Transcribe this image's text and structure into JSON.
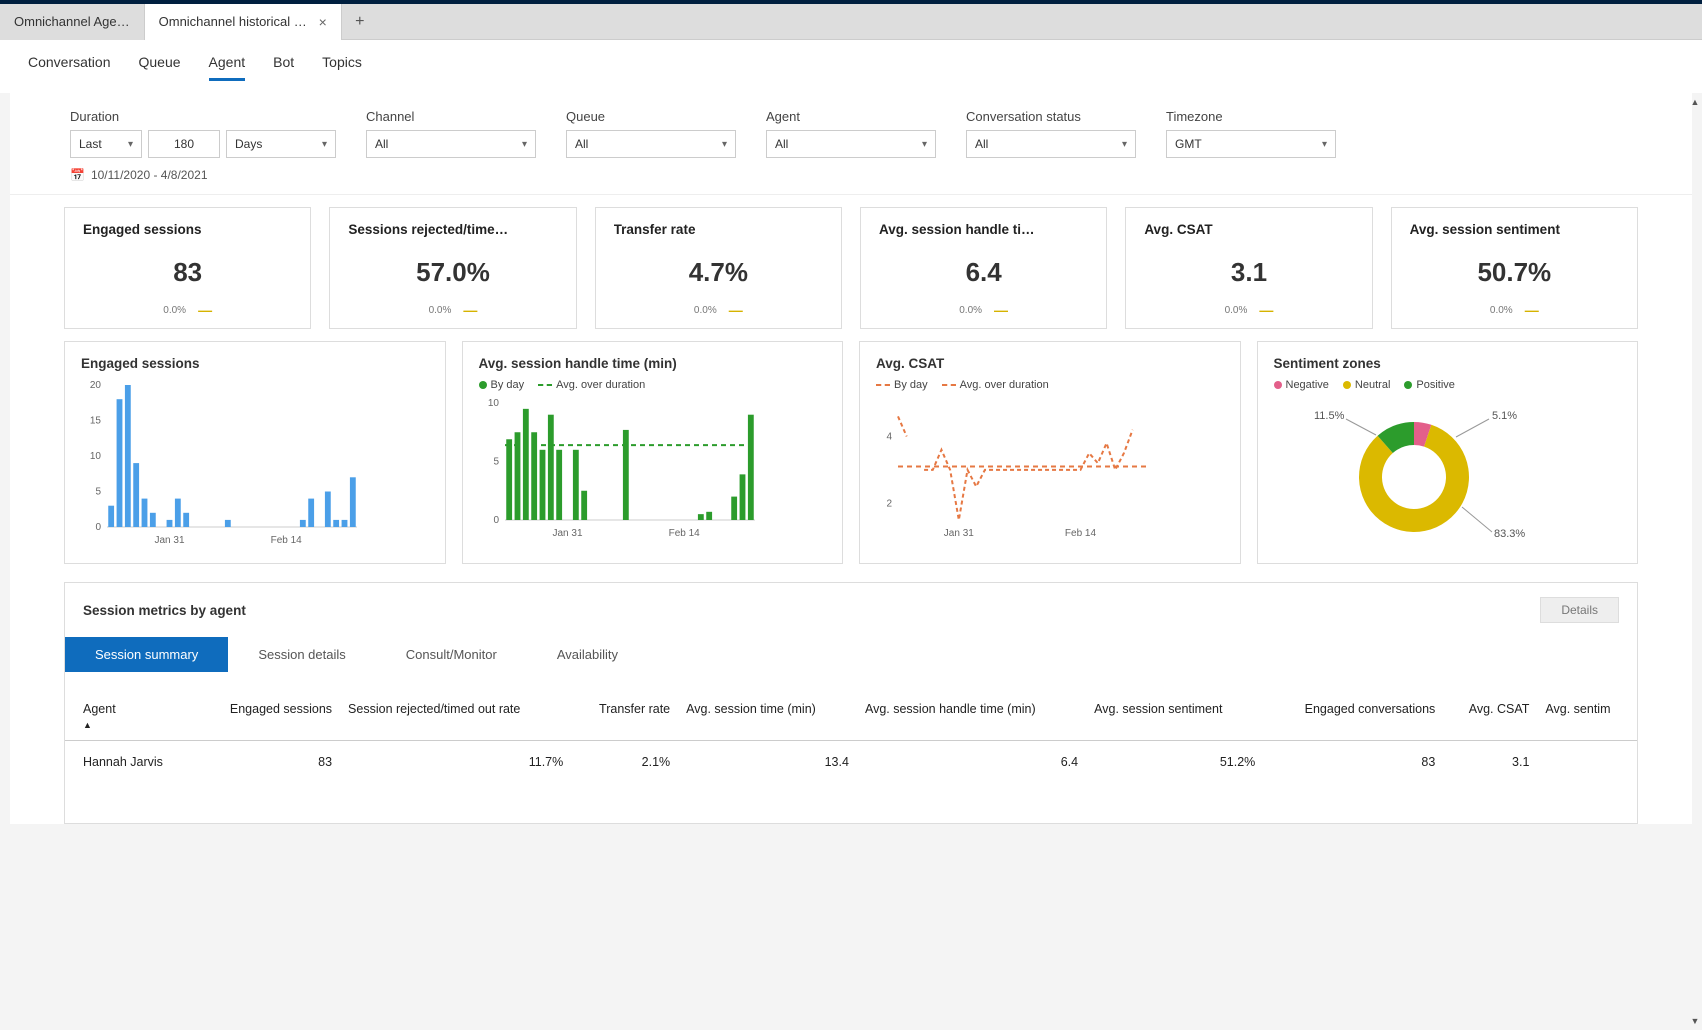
{
  "tabs": {
    "inactive": "Omnichannel Age…",
    "active": "Omnichannel historical an…"
  },
  "page_tabs": [
    "Conversation",
    "Queue",
    "Agent",
    "Bot",
    "Topics"
  ],
  "active_page_tab": "Agent",
  "filters": {
    "duration": {
      "label": "Duration",
      "mode": "Last",
      "value": "180",
      "unit": "Days"
    },
    "channel": {
      "label": "Channel",
      "value": "All"
    },
    "queue": {
      "label": "Queue",
      "value": "All"
    },
    "agent": {
      "label": "Agent",
      "value": "All"
    },
    "status": {
      "label": "Conversation status",
      "value": "All"
    },
    "timezone": {
      "label": "Timezone",
      "value": "GMT"
    }
  },
  "date_range": "10/11/2020 - 4/8/2021",
  "kpis": [
    {
      "title": "Engaged sessions",
      "value": "83",
      "delta": "0.0%"
    },
    {
      "title": "Sessions rejected/time…",
      "value": "57.0%",
      "delta": "0.0%"
    },
    {
      "title": "Transfer rate",
      "value": "4.7%",
      "delta": "0.0%"
    },
    {
      "title": "Avg. session handle ti…",
      "value": "6.4",
      "delta": "0.0%"
    },
    {
      "title": "Avg. CSAT",
      "value": "3.1",
      "delta": "0.0%"
    },
    {
      "title": "Avg. session sentiment",
      "value": "50.7%",
      "delta": "0.0%"
    }
  ],
  "charts": {
    "engaged": {
      "title": "Engaged sessions"
    },
    "handle": {
      "title": "Avg. session handle time (min)",
      "legend_byday": "By day",
      "legend_avg": "Avg. over duration"
    },
    "csat": {
      "title": "Avg. CSAT",
      "legend_byday": "By day",
      "legend_avg": "Avg. over duration"
    },
    "sentiment": {
      "title": "Sentiment zones",
      "legend_neg": "Negative",
      "legend_neu": "Neutral",
      "legend_pos": "Positive",
      "neg": "5.1%",
      "neu": "83.3%",
      "pos": "11.5%"
    }
  },
  "axis": {
    "jan31": "Jan 31",
    "feb14": "Feb 14"
  },
  "chart_data": [
    {
      "id": "engaged_sessions",
      "type": "bar",
      "title": "Engaged sessions",
      "ylabel": "",
      "ylim": [
        0,
        20
      ],
      "yticks": [
        0,
        5,
        10,
        15,
        20
      ],
      "x_ticks_shown": [
        "Jan 31",
        "Feb 14"
      ],
      "x": [
        "Jan 24",
        "Jan 25",
        "Jan 26",
        "Jan 27",
        "Jan 28",
        "Jan 29",
        "Jan 30",
        "Jan 31",
        "Feb 1",
        "Feb 2",
        "Feb 3",
        "Feb 4",
        "Feb 5",
        "Feb 6",
        "Feb 7",
        "Feb 8",
        "Feb 9",
        "Feb 10",
        "Feb 11",
        "Feb 12",
        "Feb 13",
        "Feb 14",
        "Feb 15",
        "Feb 16",
        "Feb 17",
        "Feb 18",
        "Feb 19",
        "Feb 20",
        "Feb 21",
        "Feb 22"
      ],
      "values": [
        3,
        18,
        20,
        9,
        4,
        2,
        0,
        1,
        4,
        2,
        0,
        0,
        0,
        0,
        1,
        0,
        0,
        0,
        0,
        0,
        0,
        0,
        0,
        1,
        4,
        0,
        5,
        1,
        1,
        7
      ]
    },
    {
      "id": "avg_session_handle_time",
      "type": "bar",
      "title": "Avg. session handle time (min)",
      "ylabel": "",
      "ylim": [
        0,
        10
      ],
      "yticks": [
        0,
        5,
        10
      ],
      "x_ticks_shown": [
        "Jan 31",
        "Feb 14"
      ],
      "x": [
        "Jan 24",
        "Jan 25",
        "Jan 26",
        "Jan 27",
        "Jan 28",
        "Jan 29",
        "Jan 30",
        "Jan 31",
        "Feb 1",
        "Feb 2",
        "Feb 3",
        "Feb 4",
        "Feb 5",
        "Feb 6",
        "Feb 7",
        "Feb 8",
        "Feb 9",
        "Feb 10",
        "Feb 11",
        "Feb 12",
        "Feb 13",
        "Feb 14",
        "Feb 15",
        "Feb 16",
        "Feb 17",
        "Feb 18",
        "Feb 19",
        "Feb 20",
        "Feb 21",
        "Feb 22"
      ],
      "series": [
        {
          "name": "By day",
          "type": "bar",
          "values": [
            6.9,
            7.5,
            9.5,
            7.5,
            6.0,
            9.0,
            6.0,
            0,
            6.0,
            2.5,
            0,
            0,
            0,
            0,
            7.7,
            0,
            0,
            0,
            0,
            0,
            0,
            0,
            0,
            0.5,
            0.7,
            0,
            0,
            2.0,
            3.9,
            9.0
          ]
        },
        {
          "name": "Avg. over duration",
          "type": "line",
          "style": "dashed",
          "value": 6.4
        }
      ]
    },
    {
      "id": "avg_csat",
      "type": "line",
      "title": "Avg. CSAT",
      "ylabel": "",
      "ylim": [
        1.5,
        5
      ],
      "yticks": [
        2,
        4
      ],
      "x_ticks_shown": [
        "Jan 31",
        "Feb 14"
      ],
      "x": [
        "Jan 24",
        "Jan 25",
        "Jan 26",
        "Jan 27",
        "Jan 28",
        "Jan 29",
        "Jan 30",
        "Jan 31",
        "Feb 1",
        "Feb 2",
        "Feb 3",
        "Feb 4",
        "Feb 5",
        "Feb 6",
        "Feb 7",
        "Feb 8",
        "Feb 9",
        "Feb 10",
        "Feb 11",
        "Feb 12",
        "Feb 13",
        "Feb 14",
        "Feb 15",
        "Feb 16",
        "Feb 17",
        "Feb 18",
        "Feb 19",
        "Feb 20",
        "Feb 21",
        "Feb 22"
      ],
      "series": [
        {
          "name": "By day",
          "type": "line",
          "style": "dashed",
          "values": [
            4.6,
            4.0,
            null,
            3.0,
            3.0,
            3.6,
            3.0,
            1.5,
            3.0,
            2.5,
            3.0,
            3.0,
            3.0,
            3.0,
            3.0,
            3.0,
            3.0,
            3.0,
            3.0,
            3.0,
            3.0,
            3.0,
            3.5,
            3.2,
            3.8,
            3.0,
            3.5,
            4.2,
            null,
            4.5
          ]
        },
        {
          "name": "Avg. over duration",
          "type": "line",
          "style": "dashed",
          "value": 3.1
        }
      ]
    },
    {
      "id": "sentiment_zones",
      "type": "pie",
      "title": "Sentiment zones",
      "series": [
        {
          "name": "Negative",
          "value": 5.1,
          "color": "#e35f8a"
        },
        {
          "name": "Neutral",
          "value": 83.3,
          "color": "#dbb900"
        },
        {
          "name": "Positive",
          "value": 11.5,
          "color": "#2c9c2c"
        }
      ]
    }
  ],
  "table": {
    "section_title": "Session metrics by agent",
    "details_btn": "Details",
    "tabs": [
      "Session summary",
      "Session details",
      "Consult/Monitor",
      "Availability"
    ],
    "columns": [
      "Agent",
      "Engaged sessions",
      "Session rejected/timed out rate",
      "Transfer rate",
      "Avg. session time (min)",
      "Avg. session handle time (min)",
      "Avg. session sentiment",
      "Engaged conversations",
      "Avg. CSAT",
      "Avg. sentim"
    ],
    "rows": [
      {
        "agent": "Hannah Jarvis",
        "engaged": "83",
        "rejected": "11.7%",
        "transfer": "2.1%",
        "session_time": "13.4",
        "handle_time": "6.4",
        "sentiment": "51.2%",
        "conversations": "83",
        "csat": "3.1"
      }
    ]
  }
}
